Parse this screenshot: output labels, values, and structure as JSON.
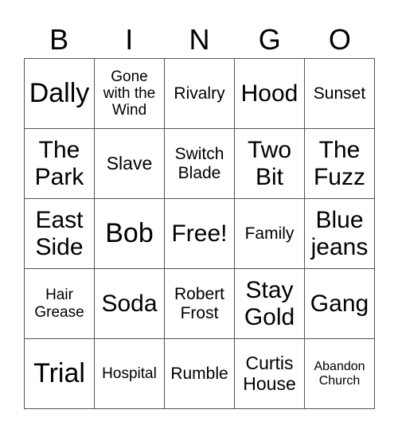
{
  "header": [
    "B",
    "I",
    "N",
    "G",
    "O"
  ],
  "cells": [
    "Dally",
    "Gone with the Wind",
    "Rivalry",
    "Hood",
    "Sunset",
    "The Park",
    "Slave",
    "Switch Blade",
    "Two Bit",
    "The Fuzz",
    "East Side",
    "Bob",
    "Free!",
    "Family",
    "Blue jeans",
    "Hair Grease",
    "Soda",
    "Robert Frost",
    "Stay Gold",
    "Gang",
    "Trial",
    "Hospital",
    "Rumble",
    "Curtis House",
    "Abandon Church"
  ]
}
